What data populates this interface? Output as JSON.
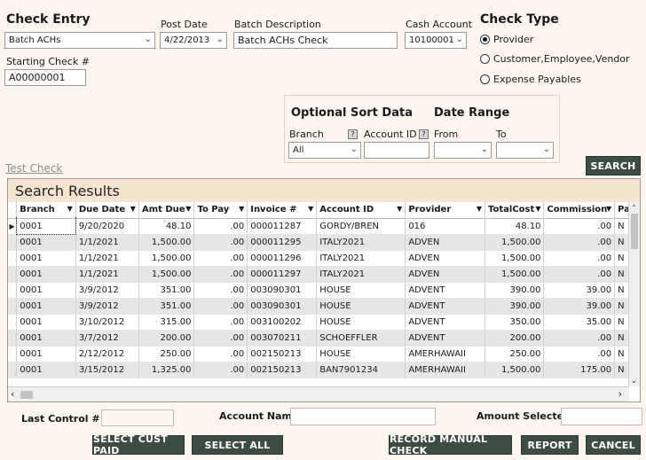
{
  "check_entry": {
    "title": "Check Entry",
    "value": "Batch ACHs"
  },
  "post_date": {
    "label": "Post Date",
    "value": "4/22/2013"
  },
  "batch_desc": {
    "label": "Batch Description",
    "value": "Batch ACHs Check"
  },
  "cash_account": {
    "label": "Cash Account",
    "value": "10100001"
  },
  "starting_check": {
    "label": "Starting Check #",
    "value": "A00000001"
  },
  "check_type": {
    "title": "Check Type",
    "options": [
      "Provider",
      "Customer,Employee,Vendor",
      "Expense Payables"
    ],
    "selected": "Provider"
  },
  "sort": {
    "title": "Optional Sort Data",
    "branch_label": "Branch",
    "branch_value": "All",
    "account_label": "Account ID",
    "q": "?"
  },
  "date_range": {
    "title": "Date Range",
    "from_label": "From",
    "to_label": "To"
  },
  "test_check": "Test Check",
  "search_button": "SEARCH",
  "results": {
    "title": "Search Results",
    "columns": [
      "Branch",
      "Due Date",
      "Amt Due",
      "To Pay",
      "Invoice #",
      "Account ID",
      "Provider",
      "TotalCost",
      "Commission",
      "Pa"
    ],
    "rows": [
      [
        "0001",
        "9/20/2020",
        "48.10",
        ".00",
        "000011287",
        "GORDY/BREN",
        "016",
        "48.10",
        ".00",
        "N"
      ],
      [
        "0001",
        "1/1/2021",
        "1,500.00",
        ".00",
        "000011295",
        "ITALY2021",
        "ADVEN",
        "1,500.00",
        ".00",
        "N"
      ],
      [
        "0001",
        "1/1/2021",
        "1,500.00",
        ".00",
        "000011296",
        "ITALY2021",
        "ADVEN",
        "1,500.00",
        ".00",
        "N"
      ],
      [
        "0001",
        "1/1/2021",
        "1,500.00",
        ".00",
        "000011297",
        "ITALY2021",
        "ADVEN",
        "1,500.00",
        ".00",
        "N"
      ],
      [
        "0001",
        "3/9/2012",
        "351.00",
        ".00",
        "003090301",
        "HOUSE",
        "ADVENT",
        "390.00",
        "39.00",
        "N"
      ],
      [
        "0001",
        "3/9/2012",
        "351.00",
        ".00",
        "003090301",
        "HOUSE",
        "ADVENT",
        "390.00",
        "39.00",
        "N"
      ],
      [
        "0001",
        "3/10/2012",
        "315.00",
        ".00",
        "003100202",
        "HOUSE",
        "ADVENT",
        "350.00",
        "35.00",
        "N"
      ],
      [
        "0001",
        "3/7/2012",
        "200.00",
        ".00",
        "003070211",
        "SCHOEFFLER",
        "ADVENT",
        "200.00",
        ".00",
        "N"
      ],
      [
        "0001",
        "2/12/2012",
        "250.00",
        ".00",
        "002150213",
        "HOUSE",
        "AMERHAWAII",
        "250.00",
        ".00",
        "N"
      ],
      [
        "0001",
        "3/15/2012",
        "1,325.00",
        ".00",
        "002150213",
        "BAN7901234",
        "AMERHAWAII",
        "1,500.00",
        "175.00",
        "N"
      ]
    ]
  },
  "footer": {
    "last_control_label": "Last Control #",
    "account_name_label": "Account Name",
    "amount_selected_label": "Amount Selected"
  },
  "buttons": {
    "select_cust_paid": "SELECT CUST PAID",
    "select_all": "SELECT ALL",
    "record_manual_check": "RECORD MANUAL CHECK",
    "report": "REPORT",
    "cancel": "CANCEL"
  }
}
